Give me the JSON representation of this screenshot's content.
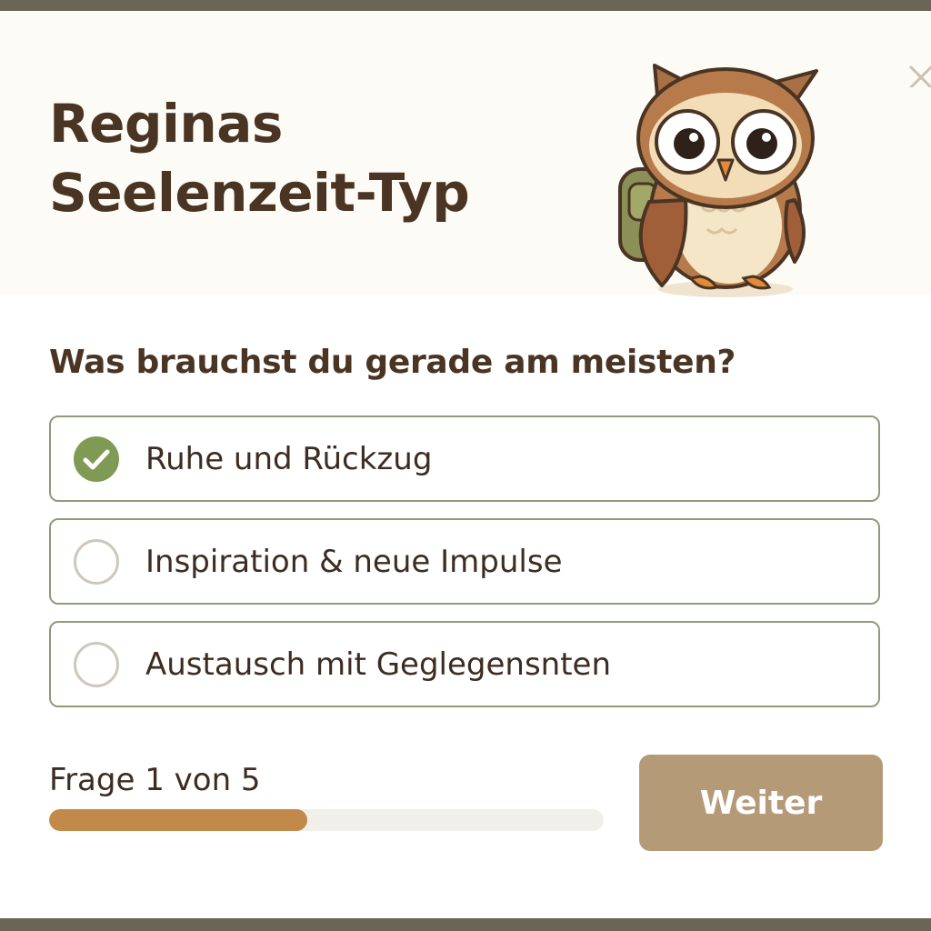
{
  "header": {
    "title_line1": "Reginas",
    "title_line2": "Seelenzeit-Typ",
    "close_icon": "close-icon",
    "mascot": "owl-with-backpack"
  },
  "question": "Was brauchst du gerade am meisten?",
  "options": [
    {
      "label": "Ruhe und Rückzug",
      "selected": true
    },
    {
      "label": "Inspiration & neue Impulse",
      "selected": false
    },
    {
      "label": "Austausch mit Geglegensnten",
      "selected": false
    }
  ],
  "progress": {
    "text": "Frage 1 von 5",
    "fraction": 0.465
  },
  "next_button": {
    "label": "Weiter"
  },
  "colors": {
    "title": "#4a3423",
    "accent_green": "#7f9a55",
    "progress_fill": "#c28a4a",
    "button": "#b59a78",
    "option_border": "#8e9c7a"
  }
}
